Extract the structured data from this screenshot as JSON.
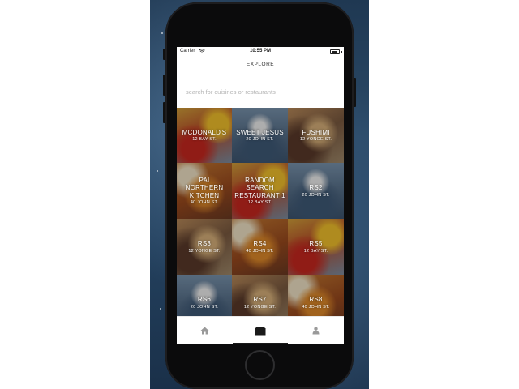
{
  "status_bar": {
    "carrier": "Carrier",
    "time": "10:55 PM",
    "battery_level": 0.7
  },
  "header": {
    "title": "EXPLORE"
  },
  "search": {
    "placeholder": "search for cuisines or restaurants",
    "value": ""
  },
  "restaurants": [
    {
      "name": "MCDONALD'S",
      "address": "12 BAY ST.",
      "image": "mcd"
    },
    {
      "name": "SWEET JESUS",
      "address": "20 JOHN ST.",
      "image": "jesus"
    },
    {
      "name": "FUSHIMI",
      "address": "12 YONGE ST.",
      "image": "fushimi"
    },
    {
      "name": "PAI NORTHERN KITCHEN",
      "address": "40 JOHN ST.",
      "image": "thai"
    },
    {
      "name": "RANDOM SEARCH RESTAURANT 1",
      "address": "12 BAY ST.",
      "image": "mcd"
    },
    {
      "name": "RS2",
      "address": "20 JOHN ST.",
      "image": "jesus"
    },
    {
      "name": "RS3",
      "address": "12 YONGE ST.",
      "image": "fushimi"
    },
    {
      "name": "RS4",
      "address": "40 JOHN ST.",
      "image": "thai"
    },
    {
      "name": "RS5",
      "address": "12 BAY ST.",
      "image": "mcd"
    },
    {
      "name": "RS6",
      "address": "20 JOHN ST.",
      "image": "jesus"
    },
    {
      "name": "RS7",
      "address": "12 YONGE ST.",
      "image": "fushimi"
    },
    {
      "name": "RS8",
      "address": "40 JOHN ST.",
      "image": "thai"
    }
  ],
  "tab_bar": {
    "tabs": [
      {
        "icon": "home-icon",
        "active": false
      },
      {
        "icon": "explore-icon",
        "active": true
      },
      {
        "icon": "profile-icon",
        "active": false
      }
    ]
  },
  "colors": {
    "tab_active_indicator": "#1a1a1a",
    "tab_inactive_icon": "#9a9a9a",
    "phone_body": "#0b0b0c"
  }
}
